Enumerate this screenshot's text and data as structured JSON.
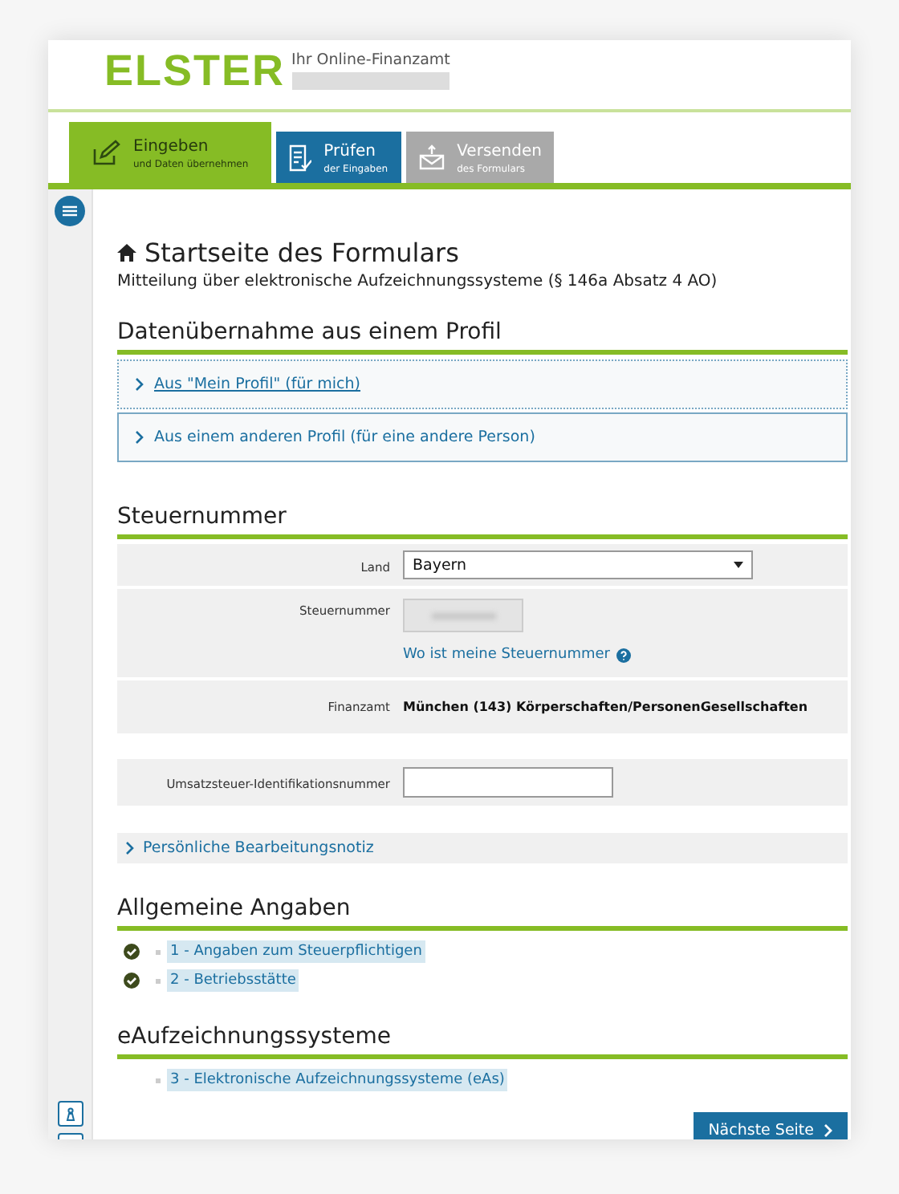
{
  "header": {
    "logo": "ELSTER",
    "tagline": "Ihr Online-Finanzamt"
  },
  "tabs": [
    {
      "title": "Eingeben",
      "subtitle": "und Daten übernehmen",
      "kind": "edit",
      "selected": true,
      "disabled": false
    },
    {
      "title": "Prüfen",
      "subtitle": "der Eingaben",
      "kind": "check",
      "selected": false,
      "disabled": false
    },
    {
      "title": "Versenden",
      "subtitle": "des Formulars",
      "kind": "send",
      "selected": false,
      "disabled": true
    }
  ],
  "page": {
    "title": "Startseite des Formulars",
    "subtitle": "Mitteilung über elektronische Aufzeichnungssysteme (§ 146a Absatz 4 AO)"
  },
  "profile_section": {
    "heading": "Datenübernahme aus einem Profil",
    "options": [
      {
        "label": "Aus \"Mein Profil\" (für mich)",
        "focused": true
      },
      {
        "label": "Aus einem anderen Profil (für eine andere Person)",
        "focused": false
      }
    ]
  },
  "tax_section": {
    "heading": "Steuernummer",
    "land": {
      "label": "Land",
      "value": "Bayern"
    },
    "tax_number": {
      "label": "Steuernummer",
      "help_link": "Wo ist meine Steuernummer"
    },
    "office": {
      "label": "Finanzamt",
      "value": "München (143) Körperschaften/PersonenGesellschaften"
    },
    "vat_id": {
      "label": "Umsatzsteuer-Identifikationsnummer"
    },
    "note": "Persönliche Bearbeitungsnotiz"
  },
  "sections": [
    {
      "heading": "Allgemeine Angaben",
      "items": [
        {
          "label": "1 - Angaben zum Steuerpflichtigen",
          "checked": true
        },
        {
          "label": "2 - Betriebsstätte",
          "checked": true
        }
      ]
    },
    {
      "heading": "eAufzeichnungssysteme",
      "items": [
        {
          "label": "3 - Elektronische Aufzeichnungssysteme (eAs)",
          "checked": false
        }
      ]
    }
  ],
  "next_button": "Nächste Seite"
}
